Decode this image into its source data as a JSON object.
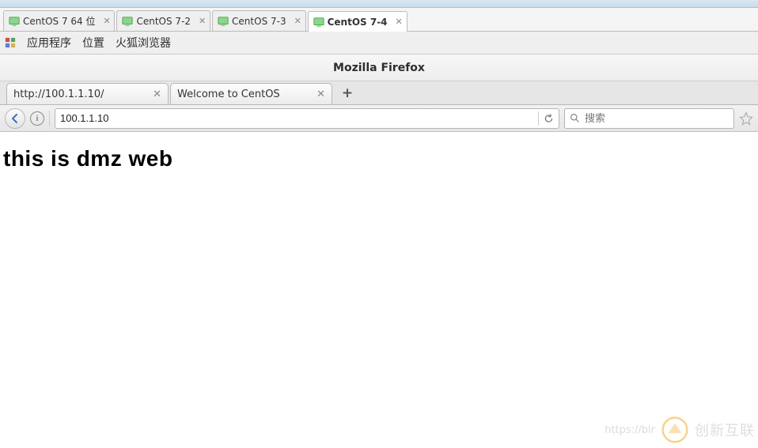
{
  "vm_tabs": [
    {
      "label": "CentOS 7 64 位",
      "active": false
    },
    {
      "label": "CentOS 7-2",
      "active": false
    },
    {
      "label": "CentOS 7-3",
      "active": false
    },
    {
      "label": "CentOS 7-4",
      "active": true
    }
  ],
  "gnome_menu": {
    "apps": "应用程序",
    "places": "位置",
    "firefox": "火狐浏览器"
  },
  "firefox": {
    "window_title": "Mozilla Firefox",
    "tabs": [
      {
        "label": "http://100.1.1.10/"
      },
      {
        "label": "Welcome to CentOS"
      }
    ],
    "url": "100.1.1.10",
    "search_placeholder": "搜索"
  },
  "page": {
    "heading": "this is dmz web"
  },
  "watermark": {
    "url": "https://blr",
    "text": "创新互联"
  }
}
